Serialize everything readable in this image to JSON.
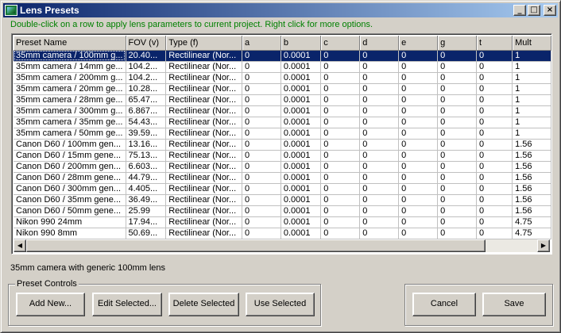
{
  "window": {
    "title": "Lens Presets"
  },
  "titlebar_buttons": {
    "minimize": "_",
    "maximize": "□",
    "close": "×"
  },
  "instruction": "Double-click on a row to apply lens parameters to current project.  Right click for more options.",
  "table": {
    "columns": [
      "Preset Name",
      "FOV (v)",
      "Type (f)",
      "a",
      "b",
      "c",
      "d",
      "e",
      "g",
      "t",
      "Mult"
    ],
    "selected_row": 0,
    "rows": [
      [
        "35mm camera / 100mm g...",
        "20.40...",
        "Rectilinear (Nor...",
        "0",
        "0.0001",
        "0",
        "0",
        "0",
        "0",
        "0",
        "1"
      ],
      [
        "35mm camera / 14mm ge...",
        "104.2...",
        "Rectilinear (Nor...",
        "0",
        "0.0001",
        "0",
        "0",
        "0",
        "0",
        "0",
        "1"
      ],
      [
        "35mm camera / 200mm g...",
        "104.2...",
        "Rectilinear (Nor...",
        "0",
        "0.0001",
        "0",
        "0",
        "0",
        "0",
        "0",
        "1"
      ],
      [
        "35mm camera / 20mm ge...",
        "10.28...",
        "Rectilinear (Nor...",
        "0",
        "0.0001",
        "0",
        "0",
        "0",
        "0",
        "0",
        "1"
      ],
      [
        "35mm camera / 28mm ge...",
        "65.47...",
        "Rectilinear (Nor...",
        "0",
        "0.0001",
        "0",
        "0",
        "0",
        "0",
        "0",
        "1"
      ],
      [
        "35mm camera / 300mm g...",
        "6.867...",
        "Rectilinear (Nor...",
        "0",
        "0.0001",
        "0",
        "0",
        "0",
        "0",
        "0",
        "1"
      ],
      [
        "35mm camera / 35mm ge...",
        "54.43...",
        "Rectilinear (Nor...",
        "0",
        "0.0001",
        "0",
        "0",
        "0",
        "0",
        "0",
        "1"
      ],
      [
        "35mm camera / 50mm ge...",
        "39.59...",
        "Rectilinear (Nor...",
        "0",
        "0.0001",
        "0",
        "0",
        "0",
        "0",
        "0",
        "1"
      ],
      [
        "Canon D60 / 100mm gen...",
        "13.16...",
        "Rectilinear (Nor...",
        "0",
        "0.0001",
        "0",
        "0",
        "0",
        "0",
        "0",
        "1.56"
      ],
      [
        "Canon D60 / 15mm gene...",
        "75.13...",
        "Rectilinear (Nor...",
        "0",
        "0.0001",
        "0",
        "0",
        "0",
        "0",
        "0",
        "1.56"
      ],
      [
        "Canon D60 / 200mm gen...",
        "6.603...",
        "Rectilinear (Nor...",
        "0",
        "0.0001",
        "0",
        "0",
        "0",
        "0",
        "0",
        "1.56"
      ],
      [
        "Canon D60 / 28mm gene...",
        "44.79...",
        "Rectilinear (Nor...",
        "0",
        "0.0001",
        "0",
        "0",
        "0",
        "0",
        "0",
        "1.56"
      ],
      [
        "Canon D60 / 300mm gen...",
        "4.405...",
        "Rectilinear (Nor...",
        "0",
        "0.0001",
        "0",
        "0",
        "0",
        "0",
        "0",
        "1.56"
      ],
      [
        "Canon D60 / 35mm gene...",
        "36.49...",
        "Rectilinear (Nor...",
        "0",
        "0.0001",
        "0",
        "0",
        "0",
        "0",
        "0",
        "1.56"
      ],
      [
        "Canon D60 / 50mm gene...",
        "25.99",
        "Rectilinear (Nor...",
        "0",
        "0.0001",
        "0",
        "0",
        "0",
        "0",
        "0",
        "1.56"
      ],
      [
        "Nikon 990 24mm",
        "17.94...",
        "Rectilinear (Nor...",
        "0",
        "0.0001",
        "0",
        "0",
        "0",
        "0",
        "0",
        "4.75"
      ],
      [
        "Nikon 990 8mm",
        "50.69...",
        "Rectilinear (Nor...",
        "0",
        "0.0001",
        "0",
        "0",
        "0",
        "0",
        "0",
        "4.75"
      ]
    ]
  },
  "scrollbar": {
    "left_arrow": "◀",
    "right_arrow": "▶"
  },
  "selected_description": "35mm camera with generic 100mm lens",
  "preset_controls": {
    "label": "Preset Controls",
    "add_new": "Add New...",
    "edit_selected": "Edit Selected...",
    "delete_selected": "Delete Selected",
    "use_selected": "Use Selected"
  },
  "dialog_buttons": {
    "cancel": "Cancel",
    "save": "Save"
  }
}
